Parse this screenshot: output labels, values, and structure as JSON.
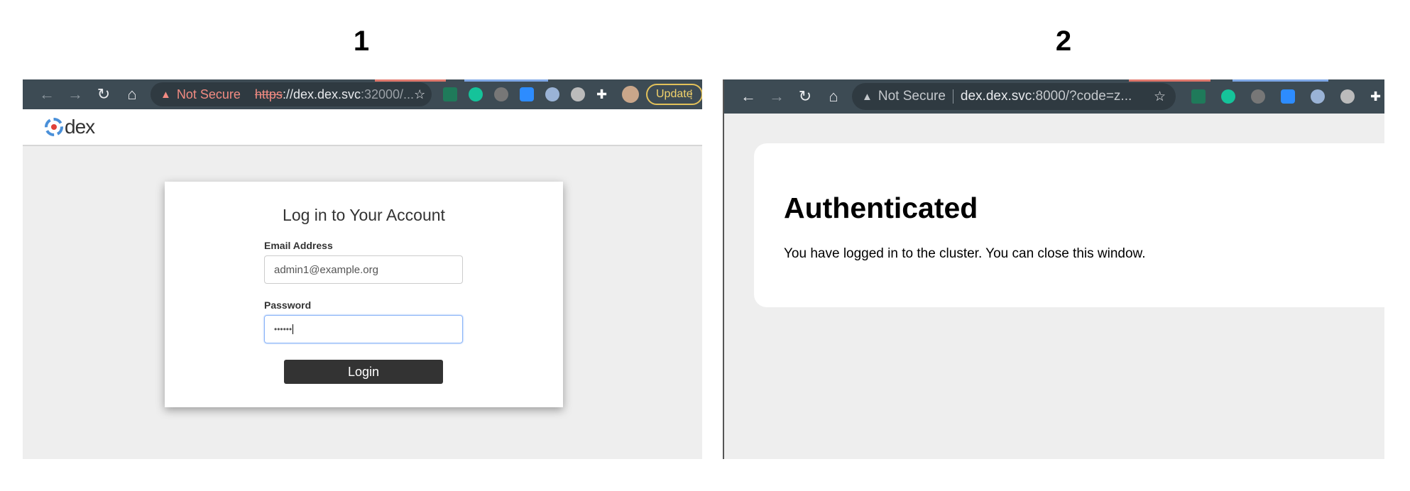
{
  "labels": [
    "1",
    "2"
  ],
  "left": {
    "browser": {
      "security": "Not Secure",
      "url_scheme": "https",
      "url_rest": "://dex.dex.svc",
      "url_port": ":32000/...",
      "update": "Update"
    },
    "logo": "dex",
    "login": {
      "title": "Log in to Your Account",
      "email_label": "Email Address",
      "email_value": "admin1@example.org",
      "password_label": "Password",
      "password_value": "••••••",
      "button": "Login"
    }
  },
  "right": {
    "browser": {
      "security": "Not Secure",
      "url_host": "dex.dex.svc",
      "url_rest": ":8000/?code=z..."
    },
    "heading": "Authenticated",
    "message": "You have logged in to the cluster. You can close this window."
  },
  "colors": {
    "toolbar": "#3d4b54",
    "button": "#333333",
    "focus": "#8ab4f8"
  }
}
